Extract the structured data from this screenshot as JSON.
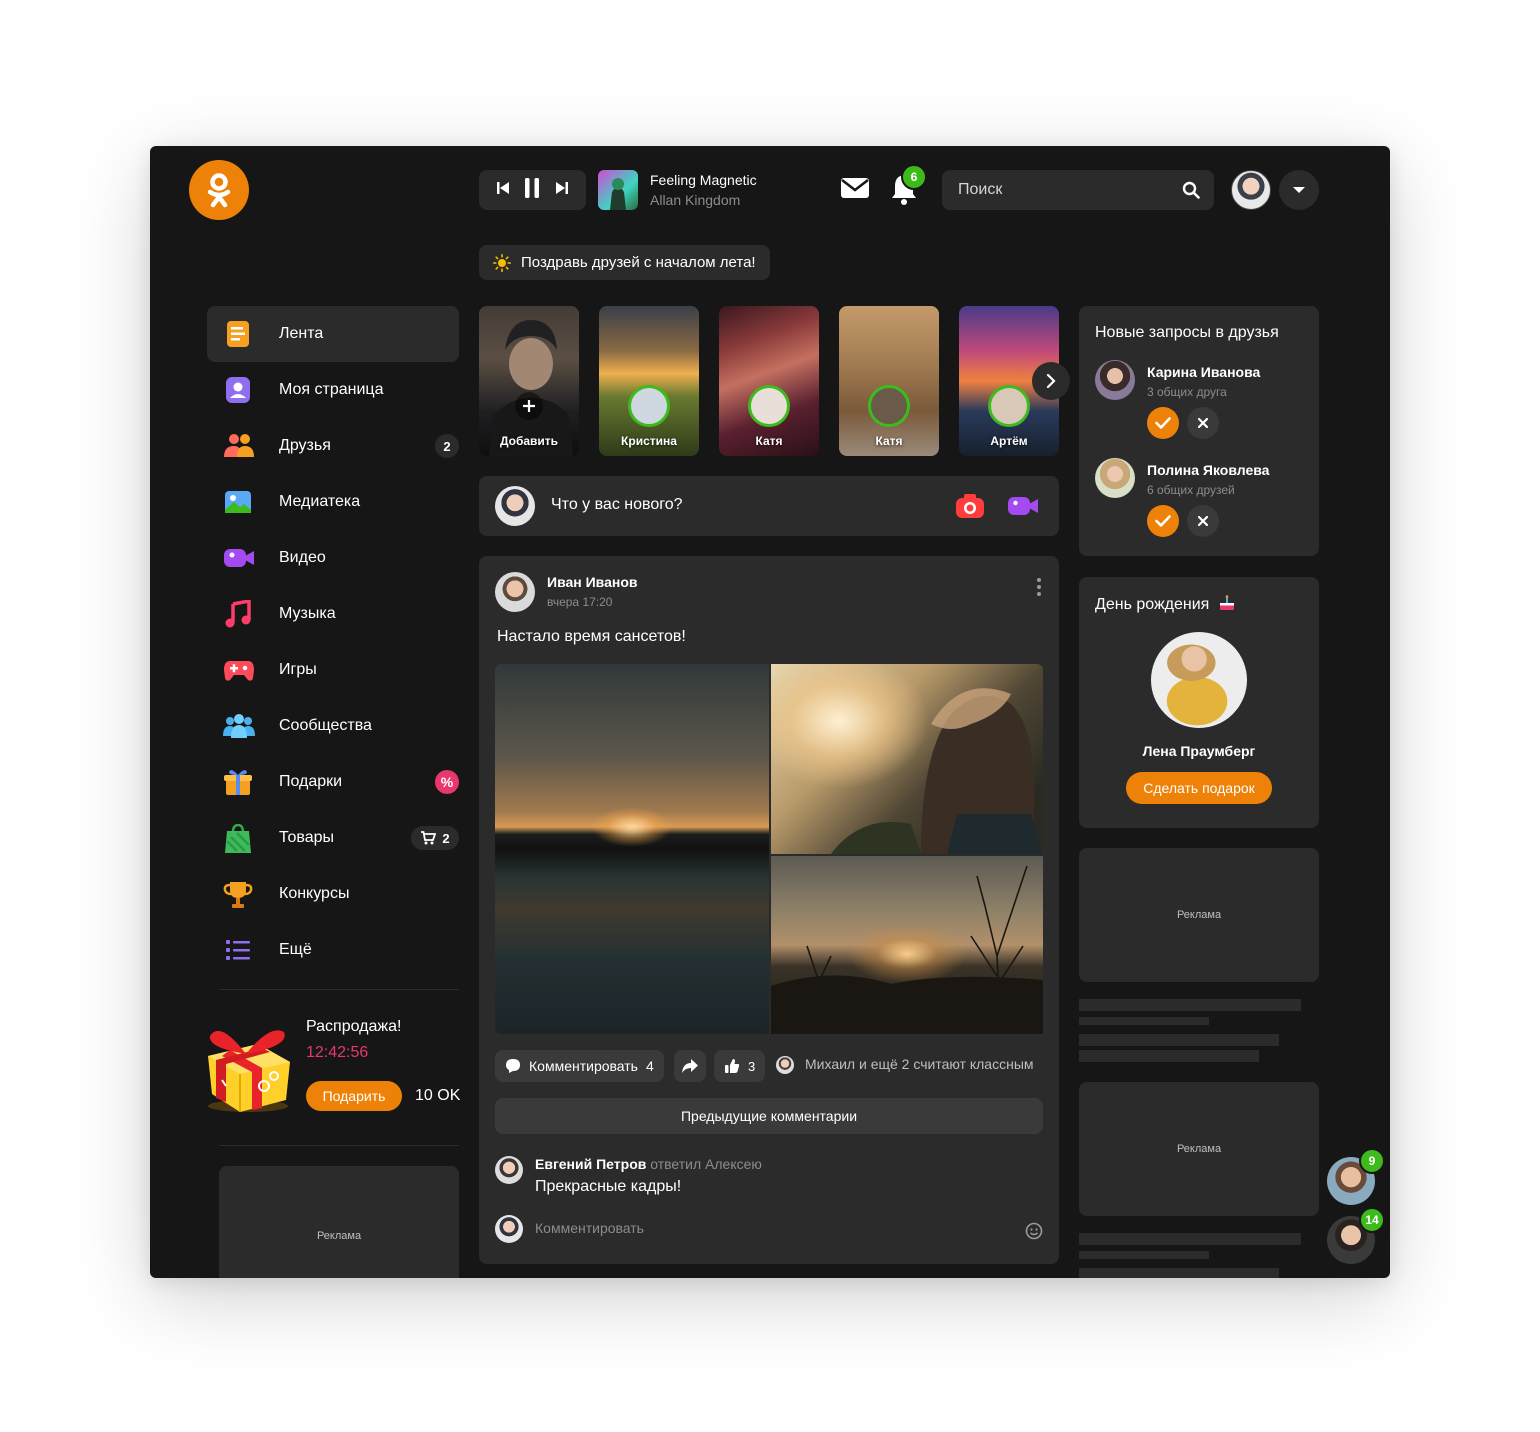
{
  "player": {
    "track_title": "Feeling Magnetic",
    "track_artist": "Allan Kingdom"
  },
  "header": {
    "notifications_count": "6",
    "search_placeholder": "Поиск"
  },
  "promo_banner": "Поздравь друзей с началом лета!",
  "sidebar": {
    "items": [
      {
        "label": "Лента",
        "icon": "feed-icon",
        "active": true
      },
      {
        "label": "Моя страница",
        "icon": "profile-icon"
      },
      {
        "label": "Друзья",
        "icon": "friends-icon",
        "count": "2"
      },
      {
        "label": "Медиатека",
        "icon": "media-icon"
      },
      {
        "label": "Видео",
        "icon": "video-icon"
      },
      {
        "label": "Музыка",
        "icon": "music-icon"
      },
      {
        "label": "Игры",
        "icon": "games-icon"
      },
      {
        "label": "Сообщества",
        "icon": "groups-icon"
      },
      {
        "label": "Подарки",
        "icon": "gifts-icon",
        "badge": "%"
      },
      {
        "label": "Товары",
        "icon": "shop-icon",
        "count": "2"
      },
      {
        "label": "Конкурсы",
        "icon": "trophy-icon"
      },
      {
        "label": "Ещё",
        "icon": "more-icon"
      }
    ],
    "sale": {
      "title": "Распродажа!",
      "timer": "12:42:56",
      "button": "Подарить",
      "price": "10 OK"
    },
    "ad_label": "Реклама"
  },
  "stories": [
    {
      "name": "Добавить"
    },
    {
      "name": "Кристина"
    },
    {
      "name": "Катя"
    },
    {
      "name": "Катя"
    },
    {
      "name": "Артём"
    }
  ],
  "composer": {
    "placeholder": "Что у вас нового?"
  },
  "post": {
    "author": "Иван Иванов",
    "time": "вчера 17:20",
    "text": "Настало время сансетов!",
    "comment_button": "Комментировать",
    "comment_count": "4",
    "like_count": "3",
    "likes_text": "Михаил и ещё 2 считают классным",
    "prev_comments": "Предыдущие комментарии",
    "comment": {
      "author": "Евгений Петров",
      "reply_text": "ответил Алексею",
      "text": "Прекрасные кадры!"
    },
    "comment_placeholder": "Комментировать"
  },
  "friend_requests": {
    "title": "Новые запросы в друзья",
    "items": [
      {
        "name": "Карина Иванова",
        "mutual": "3 общих друга"
      },
      {
        "name": "Полина Яковлева",
        "mutual": "6 общих друзей"
      }
    ]
  },
  "birthday": {
    "title": "День рождения",
    "name": "Лена Праумберг",
    "button": "Сделать подарок"
  },
  "right_ads": {
    "label1": "Реклама",
    "label2": "Реклама"
  },
  "chats": [
    {
      "count": "9"
    },
    {
      "count": "14"
    }
  ],
  "colors": {
    "accent": "#ee8208",
    "background": "#161616",
    "card": "#2b2b2b",
    "badge_green": "#3dbb1d",
    "badge_pink": "#e8376c"
  }
}
